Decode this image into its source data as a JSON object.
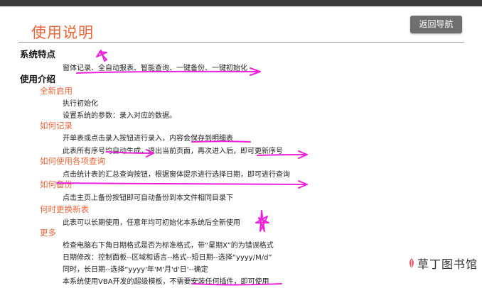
{
  "page": {
    "title": "使用说明",
    "back_label": "返回导航"
  },
  "features": {
    "heading": "系统特点",
    "text": "窗体记录、全自动报表、智能查询、一键备份、一键初始化"
  },
  "intro": {
    "heading": "使用介绍",
    "sections": [
      {
        "title": "全新启用",
        "lines": [
          "执行初始化",
          "设置系统的参数：录入对应的数据。"
        ]
      },
      {
        "title": "如何记录",
        "lines": [
          "开单表或点击录入按钮进行录入，内容会保存到明细表",
          "此表所有序号均自动生成，退出当前页面，再次进入后，即可更新序号"
        ]
      },
      {
        "title": "如何使用各项查询",
        "lines": [
          "点击统计表的汇总查询按钮，根据窗体提示进行选择日期，即可进行查询"
        ]
      },
      {
        "title": "如何备份",
        "lines": [
          "点击主页上备份按钮即可自动备份到本文件相同目录下"
        ]
      },
      {
        "title": "何时更换新表",
        "lines": [
          "此表可以长期使用，任意年均可初始化本系统后全新使用"
        ]
      },
      {
        "title": "更多",
        "lines": [
          "检查电脑右下角日期格式是否为标准格式，带“星期X”的为错误格式",
          "日期修改：控制面板--区域和语言--格式--短日期--选择“yyyy/M/d”",
          "同时，长日期--选择“yyyy'年'M'月'd'日'--确定",
          "本系统使用VBA开发的超级模板，不需要安装任何插件，即可使用"
        ]
      }
    ]
  },
  "watermark": {
    "text": "草丁图书馆"
  },
  "colors": {
    "accent": "#e8663a",
    "annotation": "#ee22dd",
    "button": "#6f6f6f",
    "topbar": "#3a3a3a"
  },
  "icons": [
    "star-doodle-icon",
    "arrow-doodle-icon",
    "leaf-logo-icon"
  ]
}
